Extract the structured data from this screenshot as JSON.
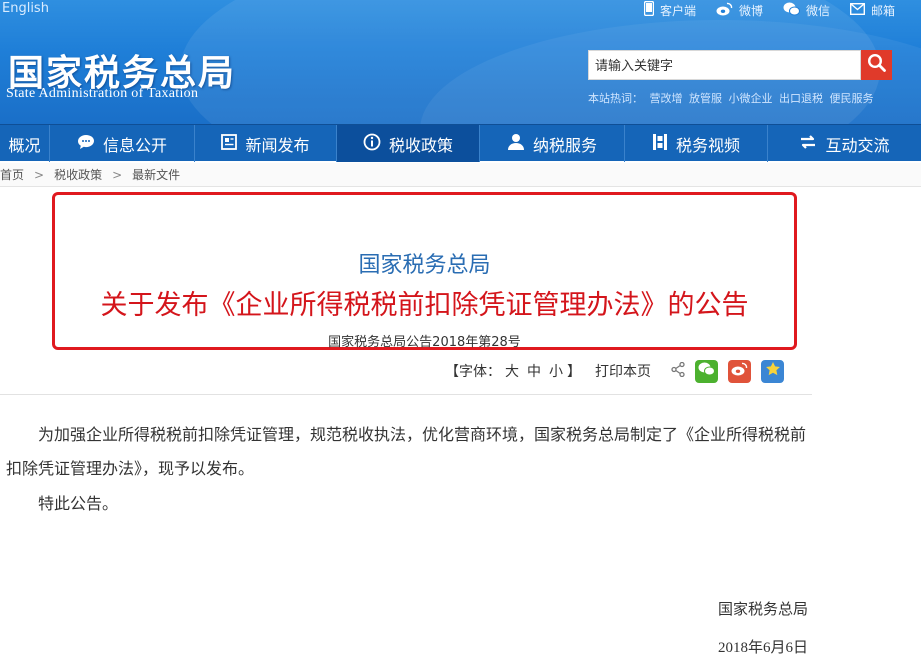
{
  "header": {
    "english_link": "English",
    "top_links": [
      {
        "label": "客户端",
        "icon": "mobile-icon"
      },
      {
        "label": "微博",
        "icon": "weibo-icon"
      },
      {
        "label": "微信",
        "icon": "wechat-icon"
      },
      {
        "label": "邮箱",
        "icon": "mail-icon"
      }
    ],
    "site_title": "国家税务总局",
    "site_subtitle": "State Administration of Taxation",
    "search": {
      "placeholder": "请输入关键字"
    },
    "hot_label": "本站热词：",
    "hot_words": [
      "营改增",
      "放管服",
      "小微企业",
      "出口退税",
      "便民服务"
    ]
  },
  "nav": {
    "items": [
      {
        "label": "概况",
        "icon": ""
      },
      {
        "label": "信息公开",
        "icon": "chat-bubble-icon"
      },
      {
        "label": "新闻发布",
        "icon": "news-icon"
      },
      {
        "label": "税收政策",
        "icon": "info-icon"
      },
      {
        "label": "纳税服务",
        "icon": "person-icon"
      },
      {
        "label": "税务视频",
        "icon": "video-icon"
      },
      {
        "label": "互动交流",
        "icon": "exchange-icon"
      }
    ],
    "active_index": 3
  },
  "breadcrumb": {
    "items": [
      "首页",
      "税收政策",
      "最新文件"
    ],
    "separator": ">"
  },
  "article": {
    "org": "国家税务总局",
    "title": "关于发布《企业所得税税前扣除凭证管理办法》的公告",
    "doc_number": "国家税务总局公告2018年第28号",
    "highlight_color": "#e0191f"
  },
  "tools": {
    "font_label_open": "【字体：",
    "size_large": "大",
    "size_medium": "中",
    "size_small": "小",
    "font_label_close": "】",
    "print_label": "打印本页"
  },
  "body": {
    "paragraph1": "为加强企业所得税税前扣除凭证管理，规范税收执法，优化营商环境，国家税务总局制定了《企业所得税税前扣除凭证管理办法》，现予以发布。",
    "paragraph2": "特此公告。",
    "signature_org": "国家税务总局",
    "signature_date": "2018年6月6日"
  }
}
